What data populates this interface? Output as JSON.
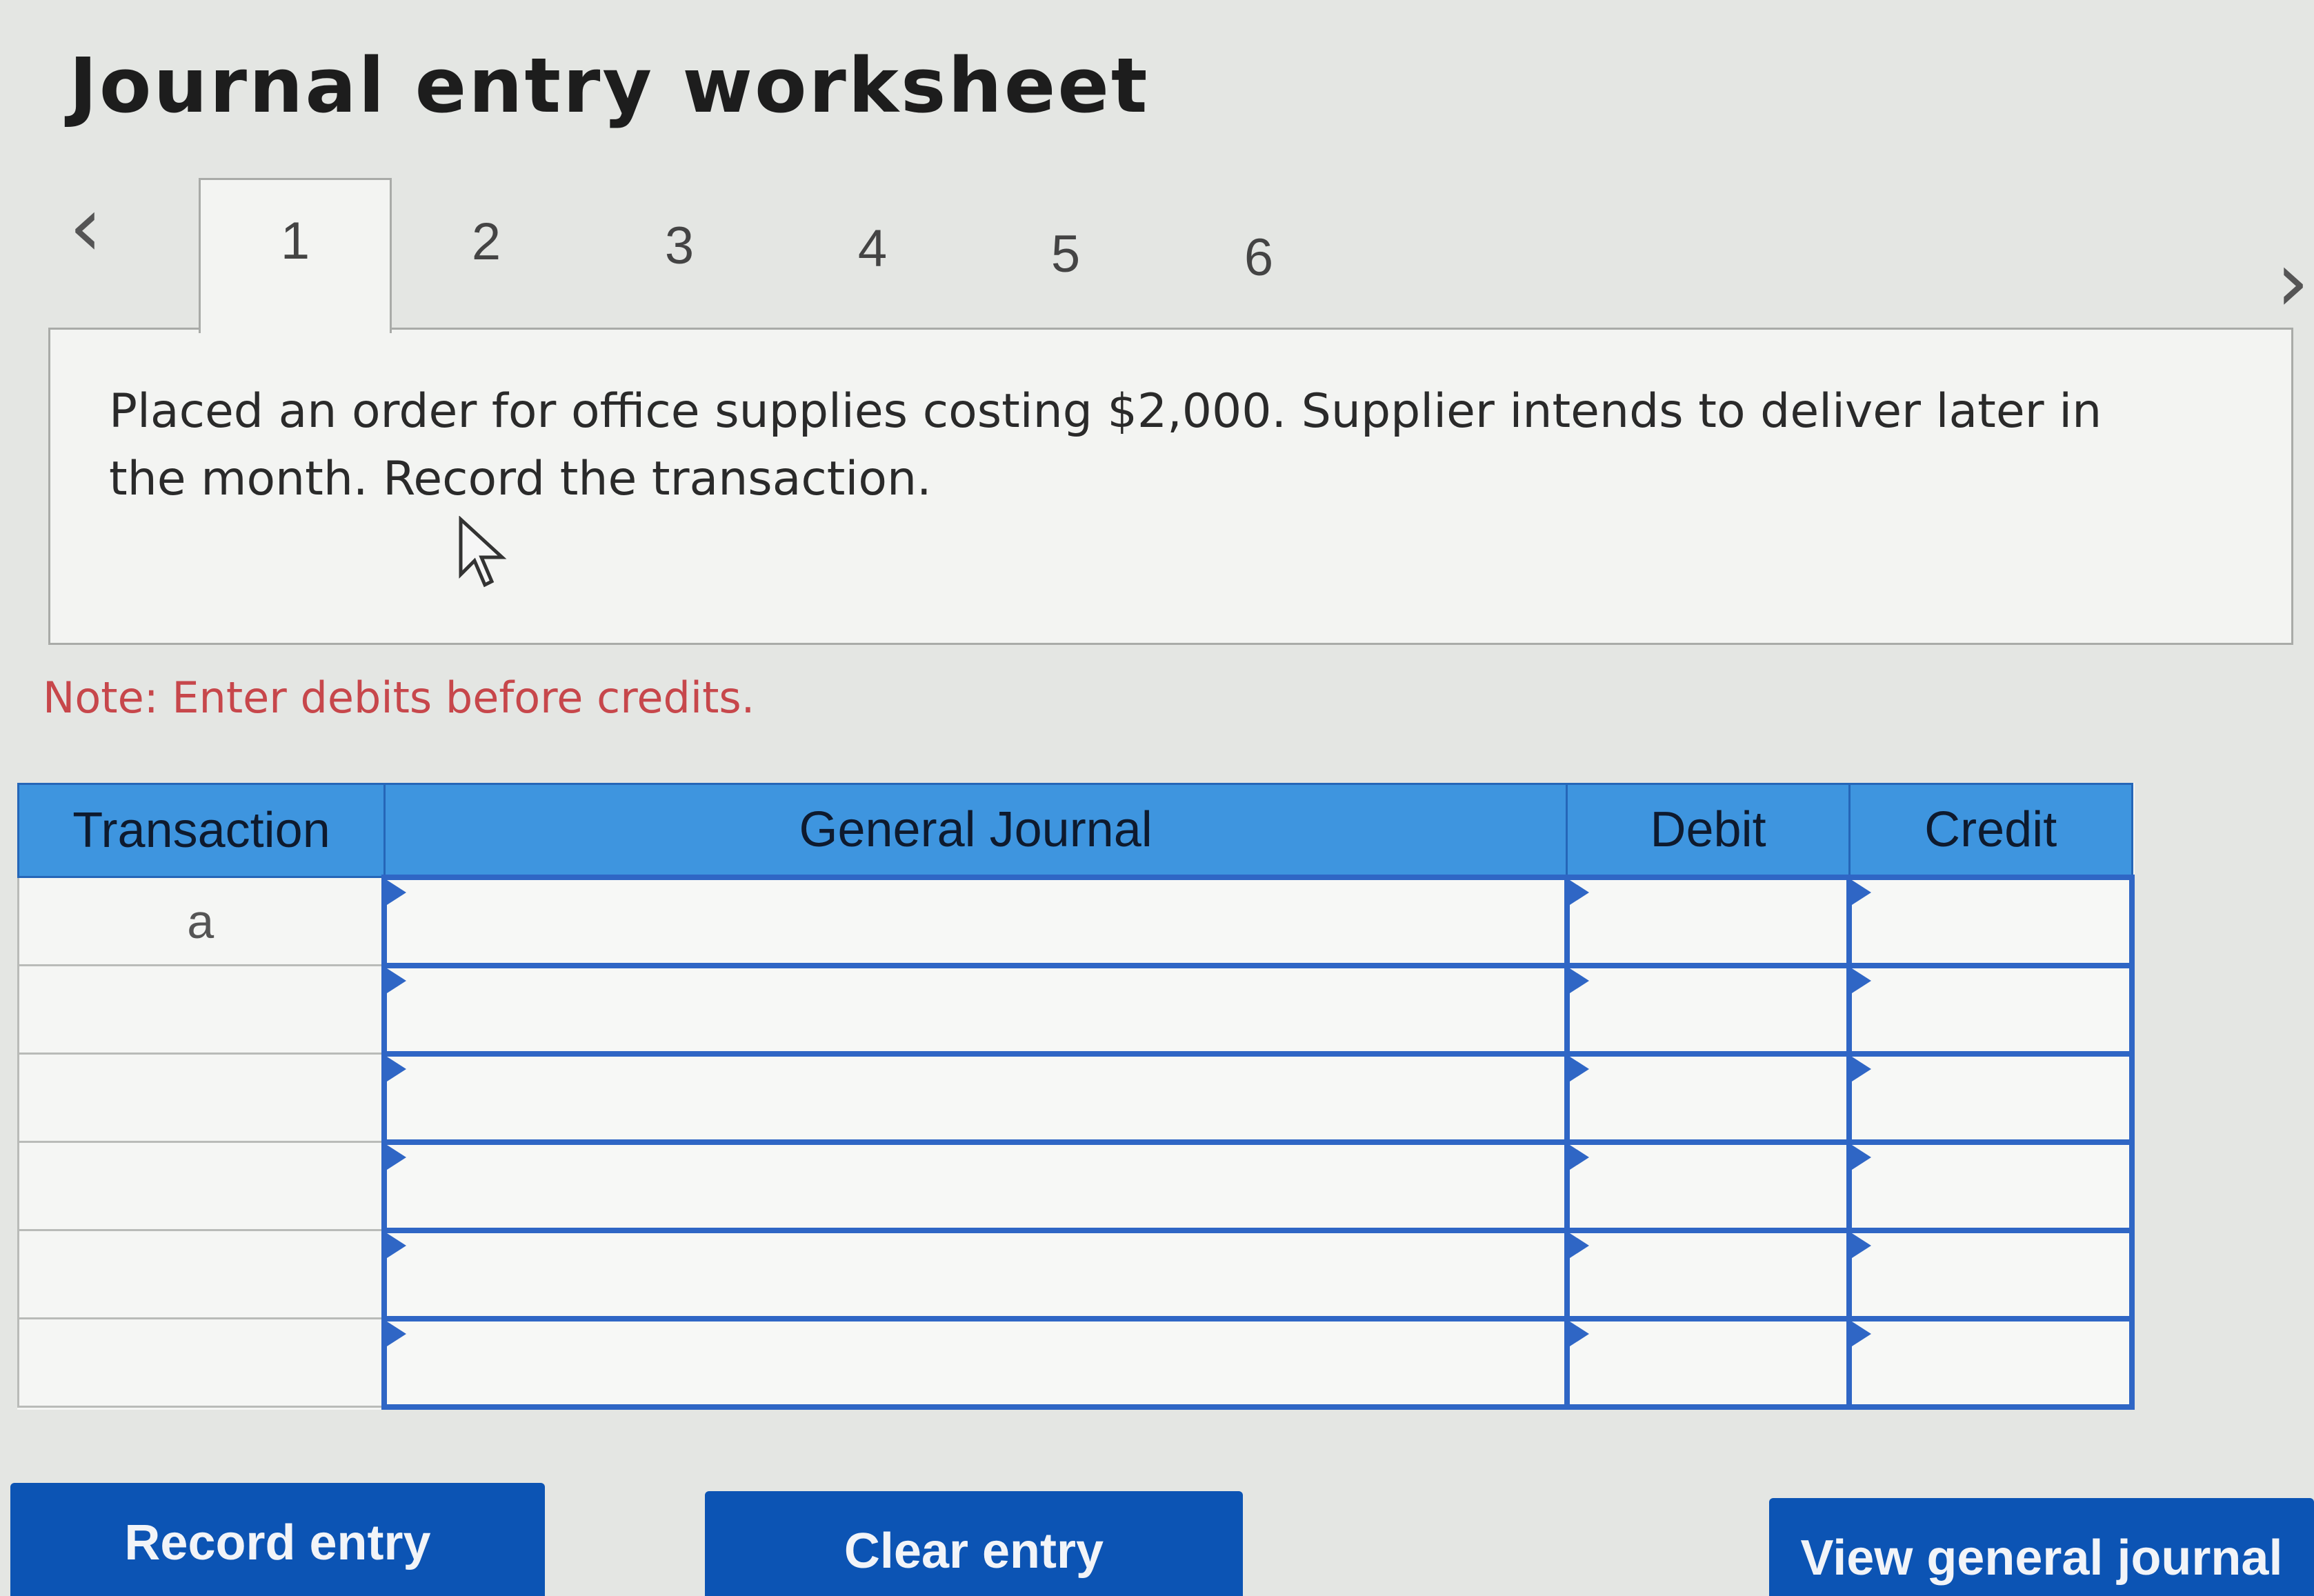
{
  "page_title": "Journal entry worksheet",
  "tabs": [
    {
      "label": "1",
      "active": true
    },
    {
      "label": "2",
      "active": false
    },
    {
      "label": "3",
      "active": false
    },
    {
      "label": "4",
      "active": false
    },
    {
      "label": "5",
      "active": false
    },
    {
      "label": "6",
      "active": false
    }
  ],
  "nav": {
    "prev_icon": "chevron-left-icon",
    "next_icon": "chevron-right-icon"
  },
  "prompt": {
    "text": "Placed an order for office supplies costing $2,000. Supplier intends to deliver later in the month. Record the transaction."
  },
  "note": "Note: Enter debits before credits.",
  "table": {
    "headers": {
      "transaction": "Transaction",
      "general_journal": "General Journal",
      "debit": "Debit",
      "credit": "Credit"
    },
    "rows": [
      {
        "transaction": "a",
        "account": "",
        "debit": "",
        "credit": ""
      },
      {
        "transaction": "",
        "account": "",
        "debit": "",
        "credit": ""
      },
      {
        "transaction": "",
        "account": "",
        "debit": "",
        "credit": ""
      },
      {
        "transaction": "",
        "account": "",
        "debit": "",
        "credit": ""
      },
      {
        "transaction": "",
        "account": "",
        "debit": "",
        "credit": ""
      },
      {
        "transaction": "",
        "account": "",
        "debit": "",
        "credit": ""
      }
    ]
  },
  "buttons": {
    "record": "Record entry",
    "clear": "Clear entry",
    "view": "View general journal"
  },
  "colors": {
    "header_blue": "#3e95df",
    "button_blue": "#0c54b4",
    "note_red": "#c7474b"
  }
}
